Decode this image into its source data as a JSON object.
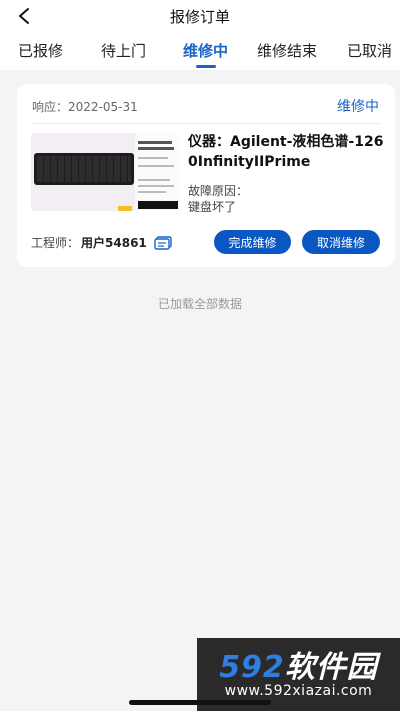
{
  "header": {
    "title": "报修订单"
  },
  "tabs": [
    {
      "label": "已报修",
      "active": false
    },
    {
      "label": "待上门",
      "active": false
    },
    {
      "label": "维修中",
      "active": true
    },
    {
      "label": "维修结束",
      "active": false
    },
    {
      "label": "已取消",
      "active": false
    }
  ],
  "order": {
    "response_label": "响应：2022-05-31",
    "status": "维修中",
    "device": "仪器：Agilent-液相色谱-1260InfinityIIPrime",
    "fault_label": "故障原因：",
    "fault_text": "键盘坏了",
    "engineer_label": "工程师：",
    "engineer_name": "用户54861",
    "complete_button": "完成维修",
    "cancel_button": "取消维修"
  },
  "footer": {
    "loaded_text": "已加载全部数据"
  },
  "watermark": {
    "title_num": "592",
    "title_text": "软件园",
    "url": "www.592xiazai.com"
  },
  "colors": {
    "accent": "#1a64c8",
    "button": "#0b57c2",
    "background": "#f4f4f6"
  }
}
